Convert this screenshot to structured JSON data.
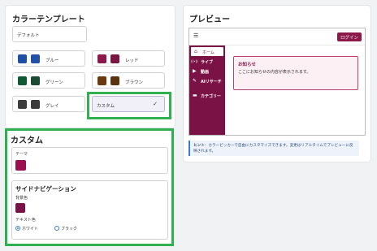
{
  "left": {
    "title": "カラーテンプレート",
    "default_label": "デフォルト",
    "templates": [
      {
        "label": "ブルー",
        "colors": [
          "#1f4fa3",
          "#2450a8"
        ]
      },
      {
        "label": "レッド",
        "colors": [
          "#8b1a4b",
          "#7a1642"
        ]
      },
      {
        "label": "グリーン",
        "colors": [
          "#0f5a33",
          "#1b4a35"
        ]
      },
      {
        "label": "ブラウン",
        "colors": [
          "#6a3a0e",
          "#5a340f"
        ]
      },
      {
        "label": "グレイ",
        "colors": [
          "#3d3d3d",
          "#3a3a3a"
        ]
      },
      {
        "label": "カスタム",
        "check": "✓"
      }
    ]
  },
  "custom": {
    "title": "カスタム",
    "theme_label": "テーマ",
    "theme_color": "#9b1150",
    "sidenav_title": "サイドナビゲーション",
    "bg_label": "背景色",
    "bg_color": "#7a1245",
    "text_label": "テキスト色",
    "radio_white": "ホワイト",
    "radio_black": "ブラック"
  },
  "preview": {
    "title": "プレビュー",
    "menu_icon": "☰",
    "login": "ログイン",
    "nav": [
      {
        "icon": "⌂",
        "label": "ホーム"
      },
      {
        "icon": "((•))",
        "label": "ライブ"
      },
      {
        "icon": "▶",
        "label": "動画"
      },
      {
        "icon": "✎",
        "label": "AIリサーチ"
      },
      {
        "icon": "▬",
        "label": "カテゴリー"
      }
    ],
    "notice_title": "お知らせ",
    "notice_text": "ここにお知らせの内容が表示されます。",
    "hint_bold": "ヒント",
    "hint_text": "：カラーピッカーで自由にカスタマイズできます。変更はリアルタイムでプレビューに反映されます。"
  },
  "colors": {
    "accent": "#8b1a4b",
    "highlight": "#2fb14f"
  }
}
